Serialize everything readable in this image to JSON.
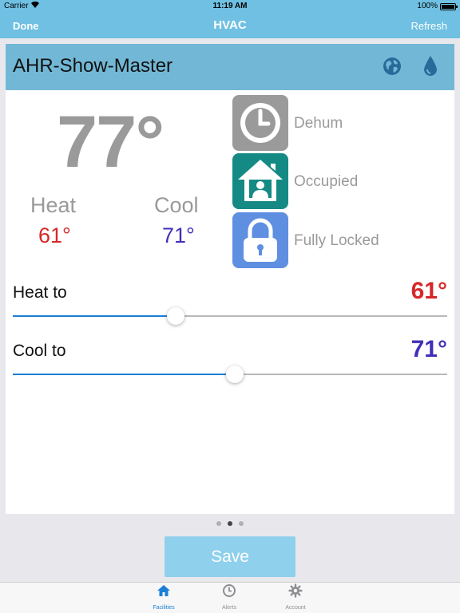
{
  "status_bar": {
    "carrier": "Carrier",
    "time": "11:19 AM",
    "battery": "100%",
    "battery_level": 1.0
  },
  "nav": {
    "left_button": "Done",
    "title": "HVAC",
    "right_button": "Refresh"
  },
  "device": {
    "name": "AHR-Show-Master",
    "header_icons": [
      "globe-icon",
      "water-drop-icon"
    ]
  },
  "temperature": {
    "current": "77°",
    "heat_label": "Heat",
    "heat_value": "61°",
    "cool_label": "Cool",
    "cool_value": "71°"
  },
  "status_tiles": [
    {
      "icon": "clock-icon",
      "label": "Dehum",
      "color": "#9a9a9a"
    },
    {
      "icon": "home-person-icon",
      "label": "Occupied",
      "color": "#158a84"
    },
    {
      "icon": "lock-icon",
      "label": "Fully Locked",
      "color": "#5f8fe0"
    }
  ],
  "setpoints": {
    "heat": {
      "label": "Heat to",
      "value": "61°",
      "slider_fraction": 0.375
    },
    "cool": {
      "label": "Cool to",
      "value": "71°",
      "slider_fraction": 0.511
    }
  },
  "pager": {
    "count": 3,
    "active_index": 1
  },
  "save_label": "Save",
  "tabs": [
    {
      "label": "Facilities",
      "icon": "home-icon",
      "active": true
    },
    {
      "label": "Alerts",
      "icon": "clock-icon",
      "active": false
    },
    {
      "label": "Account",
      "icon": "gear-icon",
      "active": false
    }
  ],
  "colors": {
    "accent": "#6fc0e2",
    "header": "#72b8d6",
    "heat": "#d62828",
    "cool": "#4030b8",
    "active_tab": "#1a7fd6"
  }
}
